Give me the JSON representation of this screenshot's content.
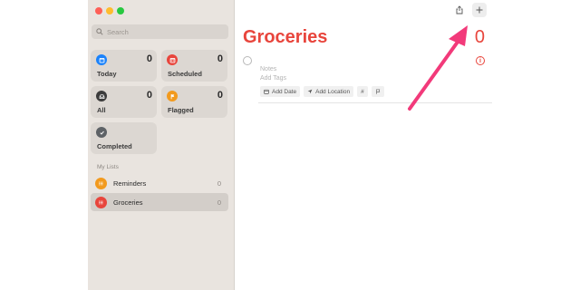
{
  "sidebar": {
    "search_placeholder": "Search",
    "smart_lists": [
      {
        "label": "Today",
        "count": "0",
        "color": "#1a82fb",
        "icon": "calendar-icon"
      },
      {
        "label": "Scheduled",
        "count": "0",
        "color": "#e8453c",
        "icon": "calendar-grid-icon"
      },
      {
        "label": "All",
        "count": "0",
        "color": "#3c3c3c",
        "icon": "tray-icon"
      },
      {
        "label": "Flagged",
        "count": "0",
        "color": "#f29a1e",
        "icon": "flag-icon"
      },
      {
        "label": "Completed",
        "count": "",
        "color": "#5e6266",
        "icon": "checkmark-icon"
      }
    ],
    "my_lists_header": "My Lists",
    "lists": [
      {
        "label": "Reminders",
        "count": "0",
        "color": "#f29a1e",
        "icon": "list-bullet-icon"
      },
      {
        "label": "Groceries",
        "count": "0",
        "color": "#e8453c",
        "icon": "list-bullet-icon",
        "selected": true
      }
    ]
  },
  "main": {
    "title": "Groceries",
    "count": "0",
    "new_item": {
      "notes_placeholder": "Notes",
      "tags_placeholder": "Add Tags",
      "chips": [
        {
          "label": "Add Date",
          "icon": "calendar-icon"
        },
        {
          "label": "Add Location",
          "icon": "location-arrow-icon"
        },
        {
          "label": "#",
          "icon": "hashtag-icon"
        },
        {
          "label": "",
          "icon": "flag-icon"
        }
      ]
    }
  },
  "colors": {
    "accent": "#e8453c",
    "annotation_arrow": "#f23a7a"
  }
}
